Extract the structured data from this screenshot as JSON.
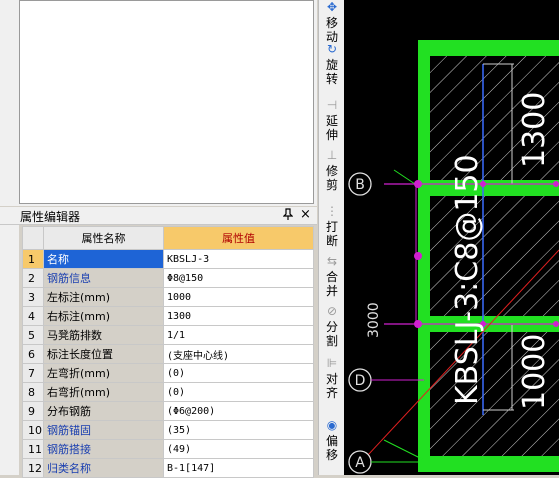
{
  "property_editor": {
    "title": "属性编辑器",
    "pin_glyph": "ᵖ",
    "close_glyph": "×",
    "columns": {
      "name": "属性名称",
      "value": "属性值"
    },
    "rows": [
      {
        "num": "1",
        "name": "名称",
        "value": "KBSLJ-3"
      },
      {
        "num": "2",
        "name": "钢筋信息",
        "value": "Φ8@150"
      },
      {
        "num": "3",
        "name": "左标注(mm)",
        "value": "1000"
      },
      {
        "num": "4",
        "name": "右标注(mm)",
        "value": "1300"
      },
      {
        "num": "5",
        "name": "马凳筋排数",
        "value": "1/1"
      },
      {
        "num": "6",
        "name": "标注长度位置",
        "value": "(支座中心线)"
      },
      {
        "num": "7",
        "name": "左弯折(mm)",
        "value": "(0)"
      },
      {
        "num": "8",
        "name": "右弯折(mm)",
        "value": "(0)"
      },
      {
        "num": "9",
        "name": "分布钢筋",
        "value": "(Φ6@200)"
      },
      {
        "num": "10",
        "name": "钢筋锚固",
        "value": "(35)"
      },
      {
        "num": "11",
        "name": "钢筋搭接",
        "value": "(49)"
      },
      {
        "num": "12",
        "name": "归类名称",
        "value": "B-1[147]"
      }
    ]
  },
  "toolbar": {
    "items": [
      {
        "label": "移动",
        "icon": "move-icon"
      },
      {
        "label": "旋转",
        "icon": "rotate-icon"
      },
      {
        "label": "延伸",
        "icon": "extend-icon"
      },
      {
        "label": "修剪",
        "icon": "trim-icon"
      },
      {
        "label": "打断",
        "icon": "break-icon"
      },
      {
        "label": "合并",
        "icon": "merge-icon"
      },
      {
        "label": "分割",
        "icon": "split-icon"
      },
      {
        "label": "对齐",
        "icon": "align-icon"
      },
      {
        "label": "偏移",
        "icon": "offset-icon"
      }
    ]
  },
  "canvas": {
    "axis_labels": [
      "B",
      "D",
      "A"
    ],
    "dimension_label": "3000",
    "rebar_label": "KBSLJ-3:C8@150",
    "right_dim_top": "1300",
    "right_dim_bottom": "1000",
    "colors": {
      "green": "#22e022",
      "magenta": "#d020d0",
      "blue": "#3a6cff",
      "red": "#e02020",
      "gray_dim": "#cfcfcf"
    }
  }
}
